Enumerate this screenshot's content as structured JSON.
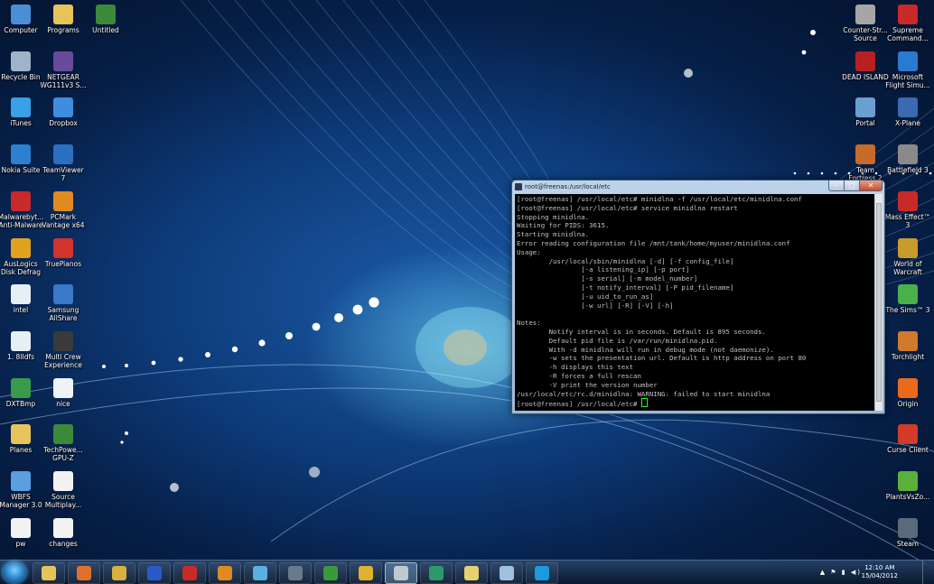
{
  "desktop": {
    "left_col1": [
      {
        "label": "Computer",
        "icon": "computer-icon",
        "color": "#4a8fd6"
      },
      {
        "label": "Recycle Bin",
        "icon": "recycle-bin-icon",
        "color": "#9fb4c8"
      },
      {
        "label": "iTunes",
        "icon": "itunes-icon",
        "color": "#3aa0e8"
      },
      {
        "label": "Nokia Suite",
        "icon": "nokia-suite-icon",
        "color": "#2d7fd0"
      },
      {
        "label": "Malwarebyt... Anti-Malware",
        "icon": "malwarebytes-icon",
        "color": "#c8292b"
      },
      {
        "label": "AusLogics Disk Defrag",
        "icon": "auslogics-icon",
        "color": "#e2a21e"
      },
      {
        "label": "intel",
        "icon": "document-icon",
        "color": "#e8eef5"
      },
      {
        "label": "1. 8IIdfs",
        "icon": "document-icon",
        "color": "#e8eef5"
      },
      {
        "label": "DXTBmp",
        "icon": "dxtbmp-icon",
        "color": "#3a9a4a"
      },
      {
        "label": "Planes",
        "icon": "folder-icon",
        "color": "#e7c45a"
      },
      {
        "label": "WBFS Manager 3.0",
        "icon": "wbfs-icon",
        "color": "#5aa0e0"
      },
      {
        "label": "pw",
        "icon": "document-icon",
        "color": "#f2f2f2"
      }
    ],
    "left_col2": [
      {
        "label": "Programs",
        "icon": "folder-icon",
        "color": "#e7c45a"
      },
      {
        "label": "NETGEAR WG111v3 S...",
        "icon": "netgear-icon",
        "color": "#6a4a9a"
      },
      {
        "label": "Dropbox",
        "icon": "dropbox-icon",
        "color": "#3d8ee0"
      },
      {
        "label": "TeamViewer 7",
        "icon": "teamviewer-icon",
        "color": "#2b6fc0"
      },
      {
        "label": "PCMark Vantage x64",
        "icon": "pcmark-icon",
        "color": "#e08a22"
      },
      {
        "label": "TruePianos",
        "icon": "truepianos-icon",
        "color": "#d0342a"
      },
      {
        "label": "Samsung AllShare",
        "icon": "allshare-icon",
        "color": "#3a78c8"
      },
      {
        "label": "Multi Crew Experience",
        "icon": "multicrew-icon",
        "color": "#3a3a3a"
      },
      {
        "label": "nice",
        "icon": "document-icon",
        "color": "#eef3f8"
      },
      {
        "label": "TechPowe... GPU-Z",
        "icon": "gpuz-icon",
        "color": "#3a8a3a"
      },
      {
        "label": "Source Multiplay...",
        "icon": "document-icon",
        "color": "#f2f2f2"
      },
      {
        "label": "changes",
        "icon": "document-icon",
        "color": "#f2f2f2"
      }
    ],
    "left_col3": [
      {
        "label": "Untitled",
        "icon": "image-icon",
        "color": "#3a8a3a"
      }
    ],
    "right_col1": [
      {
        "label": "Counter-Str... Source",
        "icon": "counter-strike-icon",
        "color": "#a6a6a6"
      },
      {
        "label": "DEAD ISLAND",
        "icon": "dead-island-icon",
        "color": "#b82020"
      },
      {
        "label": "Portal",
        "icon": "portal-icon",
        "color": "#6aa0d0"
      },
      {
        "label": "Team Fortress 2",
        "icon": "team-fortress-icon",
        "color": "#c86a2a"
      }
    ],
    "right_col2": [
      {
        "label": "Supreme Command...",
        "icon": "supreme-commander-icon",
        "color": "#c82a2a"
      },
      {
        "label": "Microsoft Flight Simu...",
        "icon": "flight-sim-icon",
        "color": "#2a7ad0"
      },
      {
        "label": "X-Plane",
        "icon": "xplane-icon",
        "color": "#3a6ab0"
      },
      {
        "label": "Battlefield 3",
        "icon": "battlefield-icon",
        "color": "#8a8a8a"
      },
      {
        "label": "Mass Effect™ 3",
        "icon": "mass-effect-icon",
        "color": "#c82a2a"
      },
      {
        "label": "World of Warcraft",
        "icon": "wow-icon",
        "color": "#c89a2a"
      },
      {
        "label": "The Sims™ 3",
        "icon": "sims-icon",
        "color": "#4ab04a"
      },
      {
        "label": "Torchlight",
        "icon": "torchlight-icon",
        "color": "#d07a2a"
      },
      {
        "label": "Origin",
        "icon": "origin-icon",
        "color": "#e86a1a"
      },
      {
        "label": "Curse Client",
        "icon": "curse-icon",
        "color": "#d23a2a"
      },
      {
        "label": "PlantsVsZo...",
        "icon": "plants-vs-zombies-icon",
        "color": "#5ab03a"
      },
      {
        "label": "Steam",
        "icon": "steam-icon",
        "color": "#5a6a7a"
      }
    ]
  },
  "terminal": {
    "title": "root@freenas:/usr/local/etc",
    "lines": [
      "[root@freenas] /usr/local/etc# minidlna -f /usr/local/etc/minidlna.conf",
      "[root@freenas] /usr/local/etc# service minidlna restart",
      "Stopping minidlna.",
      "Waiting for PIDS: 3615.",
      "Starting minidlna.",
      "Error reading configuration file /mnt/tank/home/myuser/minidlna.conf",
      "Usage:",
      "        /usr/local/sbin/minidlna [-d] [-f config_file]",
      "                [-a listening_ip] [-p port]",
      "                [-s serial] [-m model_number]",
      "                [-t notify_interval] [-P pid_filename]",
      "                [-u uid_to_run_as]",
      "                [-w url] [-R] [-V] [-h]",
      "",
      "Notes:",
      "        Notify interval is in seconds. Default is 895 seconds.",
      "        Default pid file is /var/run/minidlna.pid.",
      "        With -d minidlna will run in debug mode (not daemonize).",
      "        -w sets the presentation url. Default is http address on port 80",
      "        -h displays this text",
      "        -R forces a full rescan",
      "        -V print the version number",
      "/usr/local/etc/rc.d/minidlna: WARNING: failed to start minidlna"
    ],
    "prompt": "[root@freenas] /usr/local/etc# "
  },
  "taskbar": {
    "items": [
      {
        "name": "explorer",
        "icon": "folder-icon",
        "color": "#e7c45a",
        "active": false
      },
      {
        "name": "firefox",
        "icon": "firefox-icon",
        "color": "#e0702a",
        "active": false
      },
      {
        "name": "tools",
        "icon": "tools-icon",
        "color": "#d8b040",
        "active": false
      },
      {
        "name": "flight",
        "icon": "plane-icon",
        "color": "#2a5ac8",
        "active": false
      },
      {
        "name": "filezilla",
        "icon": "filezilla-icon",
        "color": "#c82a2a",
        "active": false
      },
      {
        "name": "media",
        "icon": "media-player-icon",
        "color": "#e08a22",
        "active": false
      },
      {
        "name": "people",
        "icon": "people-icon",
        "color": "#5ab0e0",
        "active": false
      },
      {
        "name": "steam",
        "icon": "steam-icon",
        "color": "#6a7a8a",
        "active": false
      },
      {
        "name": "cpu",
        "icon": "cpu-icon",
        "color": "#3a9a3a",
        "active": false
      },
      {
        "name": "chrome",
        "icon": "chrome-icon",
        "color": "#e0b030",
        "active": false
      },
      {
        "name": "putty",
        "icon": "putty-icon",
        "color": "#c0c8d0",
        "active": true
      },
      {
        "name": "app",
        "icon": "app-icon",
        "color": "#2a9a6a",
        "active": false
      },
      {
        "name": "folders",
        "icon": "folder-icon",
        "color": "#e7d070",
        "active": false
      },
      {
        "name": "window",
        "icon": "window-icon",
        "color": "#a0c0e0",
        "active": false
      },
      {
        "name": "skype",
        "icon": "skype-icon",
        "color": "#1a9ae0",
        "active": false
      }
    ],
    "clock_time": "12:10 AM",
    "clock_date": "15/04/2012"
  }
}
